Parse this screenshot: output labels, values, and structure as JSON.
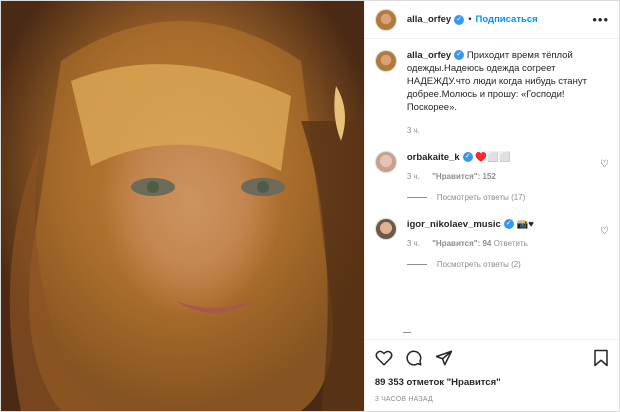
{
  "header": {
    "username": "alla_orfey",
    "separator": "•",
    "follow_label": "Подписаться",
    "more_icon": "more-dots-icon"
  },
  "caption": {
    "username": "alla_orfey",
    "text": "Приходит время тёплой одежды.Надеюсь одежда согреет НАДЕЖДУ.что люди когда нибудь станут добрее.Молюсь и прошу: «Господи!Поскорее».",
    "time": "3 ч."
  },
  "comments": [
    {
      "username": "orbakaite_k",
      "text": "♥️⬜⬜",
      "time": "3 ч.",
      "likes": "\"Нравится\": 152",
      "reply": "",
      "view_replies": "Посмотреть ответы (17)"
    },
    {
      "username": "igor_nikolaev_music",
      "text": "📸♥",
      "time": "3 ч.",
      "likes": "\"Нравится\": 94",
      "reply": "Ответить",
      "view_replies": "Посмотреть ответы (2)"
    }
  ],
  "footer": {
    "likes": "89 353 отметок \"Нравится\"",
    "posted": "3 ЧАСОВ НАЗАД"
  },
  "colors": {
    "accent": "#0095f6",
    "verified": "#3897f0"
  }
}
